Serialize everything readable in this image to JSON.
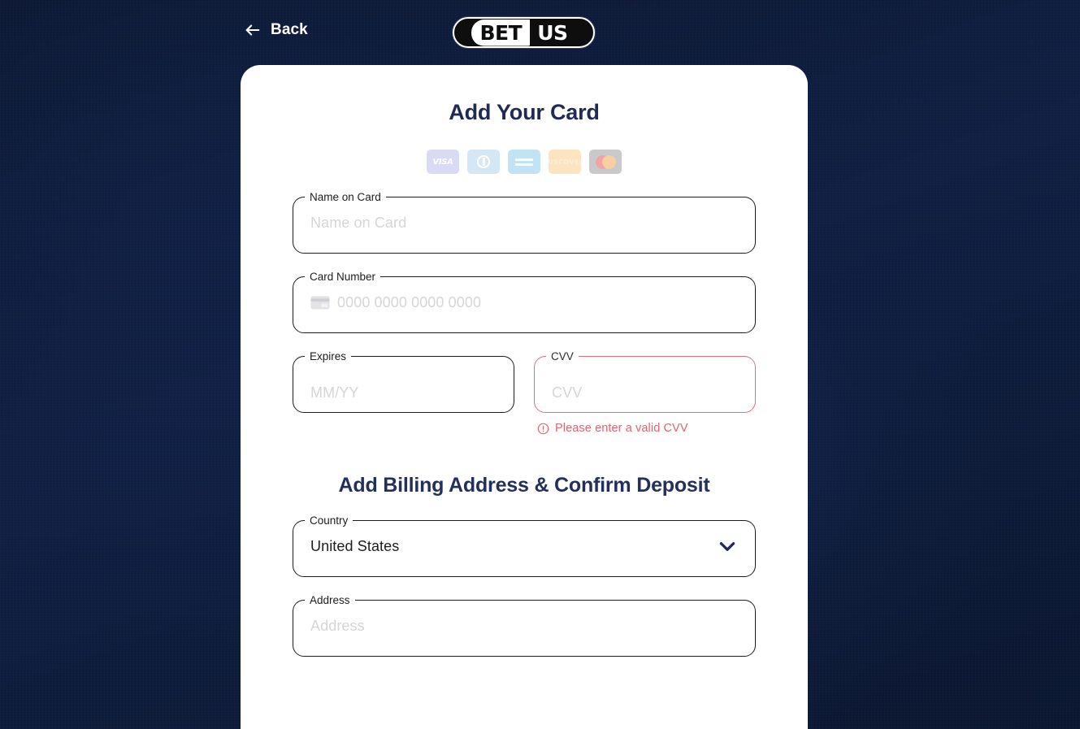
{
  "topbar": {
    "back_label": "Back",
    "back_icon": "arrow-left-icon",
    "logo": {
      "part1": "BET",
      "part2": "US",
      "alt": "BetUS"
    }
  },
  "card": {
    "heading_primary": "Add Your Card",
    "heading_secondary": "Add Billing Address & Confirm Deposit",
    "accepted_cards": [
      {
        "name": "visa",
        "label": "VISA"
      },
      {
        "name": "diners-club",
        "label": ""
      },
      {
        "name": "amex",
        "label": ""
      },
      {
        "name": "discover",
        "label": "DISCOVER"
      },
      {
        "name": "mastercard",
        "label": ""
      }
    ],
    "fields": {
      "name_on_card": {
        "label": "Name on Card",
        "placeholder": "Name on Card",
        "value": ""
      },
      "card_number": {
        "label": "Card Number",
        "placeholder": "0000 0000 0000 0000",
        "value": "",
        "icon": "credit-card-icon"
      },
      "expires": {
        "label": "Expires",
        "placeholder": "MM/YY",
        "value": ""
      },
      "cvv": {
        "label": "CVV",
        "placeholder": "CVV",
        "value": "",
        "error": "Please enter a valid CVV",
        "error_icon": "error-circle-icon"
      },
      "country": {
        "label": "Country",
        "value": "United States",
        "icon": "chevron-down-icon"
      },
      "address": {
        "label": "Address",
        "placeholder": "Address",
        "value": ""
      }
    }
  },
  "colors": {
    "page_background": "#0b1733",
    "card_background": "#ffffff",
    "heading": "#1f2a55",
    "field_border": "#1c1c1c",
    "error": "#e0707d",
    "placeholder": "#d6d6d8",
    "chevron": "#1f2a55"
  }
}
